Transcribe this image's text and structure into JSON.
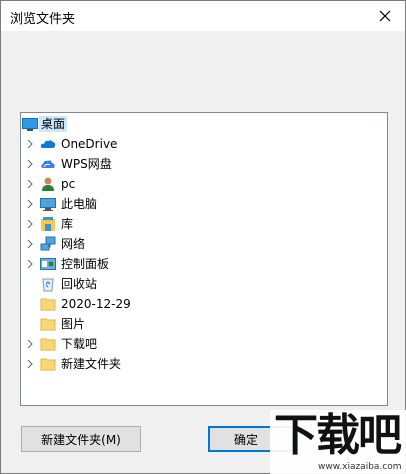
{
  "window": {
    "title": "浏览文件夹",
    "close_icon": "close-icon"
  },
  "tree": {
    "root": {
      "label": "桌面",
      "icon": "desktop-icon",
      "selected": true
    },
    "items": [
      {
        "label": "OneDrive",
        "icon": "onedrive-cloud-icon",
        "expandable": true
      },
      {
        "label": "WPS网盘",
        "icon": "wps-cloud-icon",
        "expandable": true
      },
      {
        "label": "pc",
        "icon": "user-icon",
        "expandable": true
      },
      {
        "label": "此电脑",
        "icon": "computer-icon",
        "expandable": true
      },
      {
        "label": "库",
        "icon": "library-icon",
        "expandable": true
      },
      {
        "label": "网络",
        "icon": "network-icon",
        "expandable": true
      },
      {
        "label": "控制面板",
        "icon": "control-panel-icon",
        "expandable": true
      },
      {
        "label": "回收站",
        "icon": "recycle-bin-icon",
        "expandable": false
      },
      {
        "label": "2020-12-29",
        "icon": "folder-icon",
        "expandable": false
      },
      {
        "label": "图片",
        "icon": "folder-icon",
        "expandable": false
      },
      {
        "label": "下载吧",
        "icon": "folder-icon",
        "expandable": true
      },
      {
        "label": "新建文件夹",
        "icon": "folder-icon",
        "expandable": true
      }
    ]
  },
  "buttons": {
    "new_folder": "新建文件夹(M)",
    "ok": "确定"
  },
  "watermark": {
    "big": "下载吧",
    "small": "www.xiazaiba.com"
  },
  "colors": {
    "selection": "#cce8ff",
    "accent": "#0078d7",
    "folder": "#f8d775"
  }
}
